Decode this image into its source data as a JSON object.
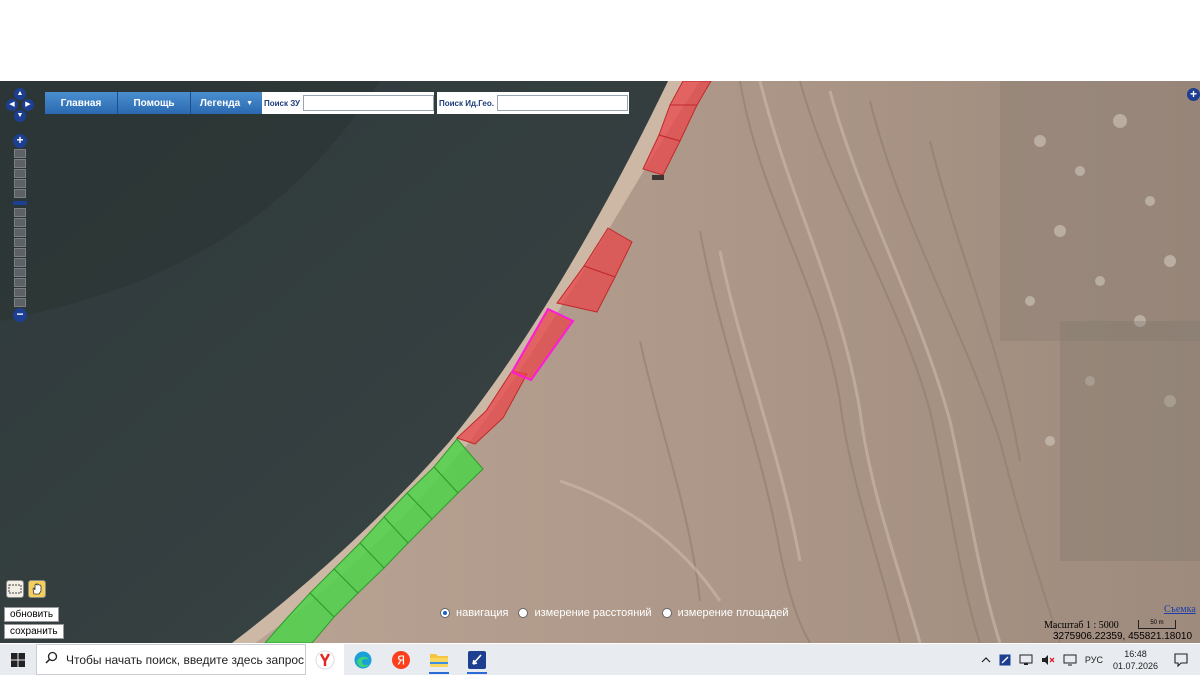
{
  "menu": {
    "home": "Главная",
    "help": "Помощь",
    "legend": "Легенда"
  },
  "search": {
    "land_label": "Поиск ЗУ",
    "land_value": "",
    "geo_label": "Поиск Ид.Гео.",
    "geo_value": ""
  },
  "map_controls": {
    "zoom_in": "+",
    "zoom_out": "−",
    "expand": "+",
    "zoom_levels_total": 16,
    "zoom_level_active": 5
  },
  "tools": {
    "refresh": "обновить",
    "save": "сохранить"
  },
  "modes": {
    "items": [
      {
        "label": "навигация",
        "selected": true
      },
      {
        "label": "измерение расстояний",
        "selected": false
      },
      {
        "label": "измерение площадей",
        "selected": false
      }
    ]
  },
  "status": {
    "scale": "Масштаб 1 : 5000",
    "scale_bar": "50 m",
    "coords": "3275906.22359, 455821.18010",
    "survey_link": "Съемка"
  },
  "parcels": {
    "red_color": "#e8474a",
    "green_color": "#4ed24a",
    "selected_outline": "#ff1ad9"
  },
  "taskbar": {
    "search_placeholder": "Чтобы начать поиск, введите здесь запрос",
    "apps": [
      "yandex-browser-icon",
      "edge-icon",
      "yandex-icon",
      "file-explorer-icon",
      "app-icon"
    ],
    "lang": "РУС",
    "time": "16:48",
    "date": "01.07.2026"
  }
}
